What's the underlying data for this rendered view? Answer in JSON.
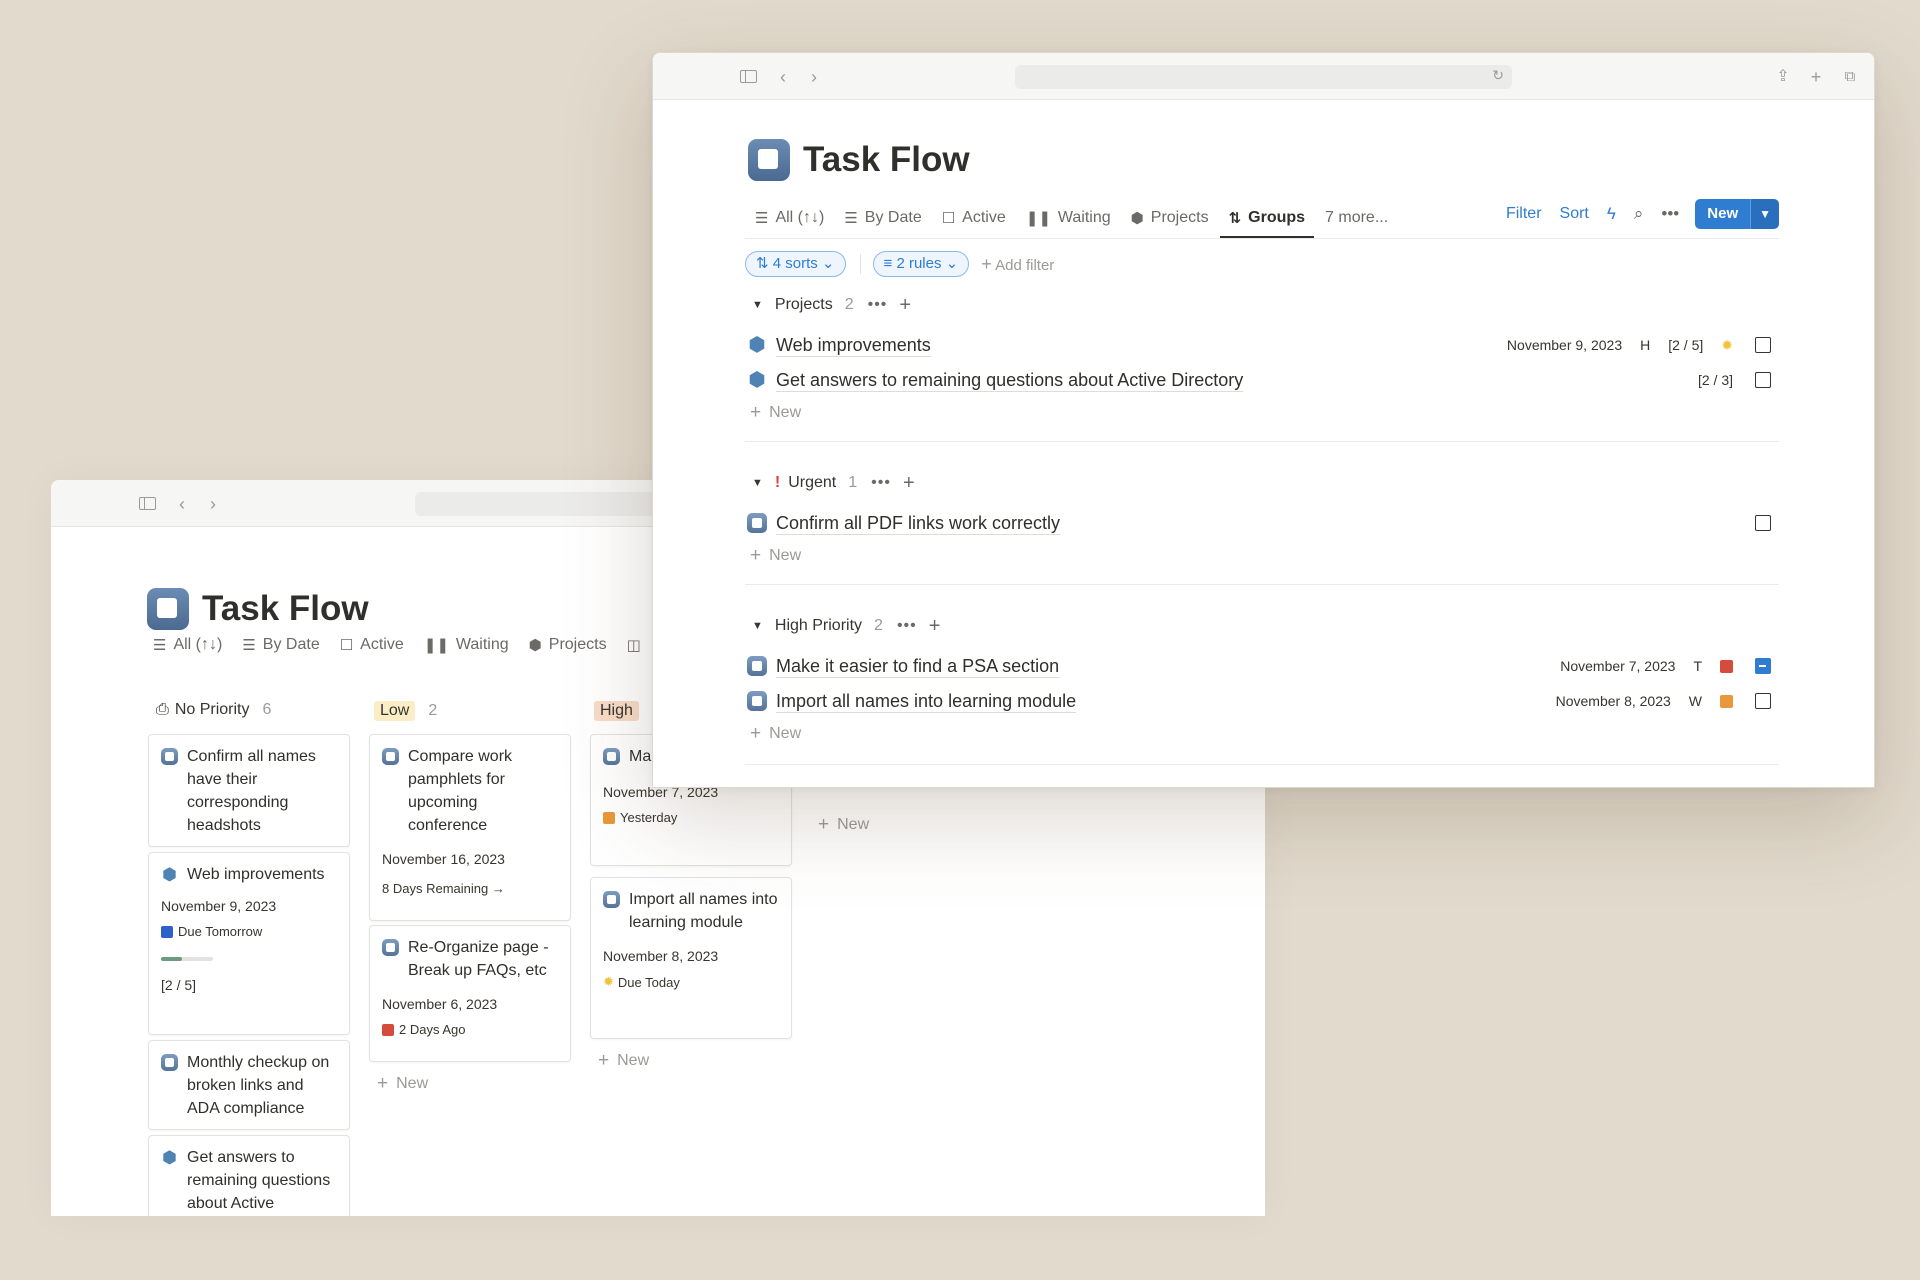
{
  "back_window": {
    "title": "Task Flow",
    "tabs": [
      {
        "label": "All (↑↓)",
        "icon": "list-icon"
      },
      {
        "label": "By Date",
        "icon": "list-icon"
      },
      {
        "label": "Active",
        "icon": "checkbox-icon"
      },
      {
        "label": "Waiting",
        "icon": "pause-icon"
      },
      {
        "label": "Projects",
        "icon": "cube-icon"
      }
    ],
    "columns": [
      {
        "label": "No Priority",
        "count": "6"
      },
      {
        "label": "Low",
        "count": "2"
      },
      {
        "label": "High"
      }
    ],
    "cards": {
      "np1": {
        "title": "Confirm all names have their corresponding headshots"
      },
      "np2": {
        "title": "Web improvements",
        "date": "November 9, 2023",
        "status": "Due Tomorrow",
        "progress": 0.4,
        "fraction": "[2 / 5]"
      },
      "np3": {
        "title": "Monthly checkup on broken links and ADA compliance"
      },
      "np4": {
        "title": "Get answers to remaining questions about Active"
      },
      "low1": {
        "title": "Compare work pamphlets for upcoming conference",
        "date": "November 16, 2023",
        "status": "8 Days Remaining →"
      },
      "low2": {
        "title": "Re-Organize page - Break up FAQs, etc",
        "date": "November 6, 2023",
        "status": "2 Days Ago"
      },
      "high1": {
        "title": "Ma fin",
        "date": "November 7, 2023",
        "status": "Yesterday"
      },
      "high2": {
        "title": "Import all names into learning module",
        "date": "November 8, 2023",
        "status": "Due Today"
      }
    },
    "new_label": "New"
  },
  "front_window": {
    "title": "Task Flow",
    "tabs": [
      {
        "label": "All (↑↓)",
        "icon": "list-icon"
      },
      {
        "label": "By Date",
        "icon": "list-icon"
      },
      {
        "label": "Active",
        "icon": "checkbox-icon"
      },
      {
        "label": "Waiting",
        "icon": "pause-icon"
      },
      {
        "label": "Projects",
        "icon": "cube-icon"
      },
      {
        "label": "Groups",
        "icon": "sort-icon"
      },
      {
        "label": "7 more..."
      }
    ],
    "toolbar": {
      "filter": "Filter",
      "sort": "Sort",
      "new": "New"
    },
    "pills": {
      "sorts": "4 sorts",
      "rules": "2 rules",
      "add_filter": "Add filter"
    },
    "groups": [
      {
        "label": "Projects",
        "count": "2",
        "rows": [
          {
            "title": "Web improvements",
            "date": "November 9, 2023",
            "letter": "H",
            "fraction": "[2 / 5]",
            "checked": false
          },
          {
            "title": "Get answers to remaining questions about Active Directory",
            "fraction": "[2 / 3]",
            "checked": false
          }
        ]
      },
      {
        "label": "Urgent",
        "count": "1",
        "rows": [
          {
            "title": "Confirm all PDF links work correctly",
            "checked": false
          }
        ]
      },
      {
        "label": "High Priority",
        "count": "2",
        "rows": [
          {
            "title": "Make it easier to find a PSA section",
            "date": "November 7, 2023",
            "letter": "T",
            "checked": true
          },
          {
            "title": "Import all names into learning module",
            "date": "November 8, 2023",
            "letter": "W",
            "checked": false
          }
        ]
      }
    ],
    "new_label": "New"
  },
  "colors": {
    "accent": "#2f7dd1",
    "low_tag_bg": "#fbeec6",
    "high_tag_bg": "#f8dcc8",
    "status_red": "#d44c3c",
    "status_orange": "#e8983a",
    "status_blue": "#2d62c8",
    "status_yellow": "#f2c23a"
  }
}
